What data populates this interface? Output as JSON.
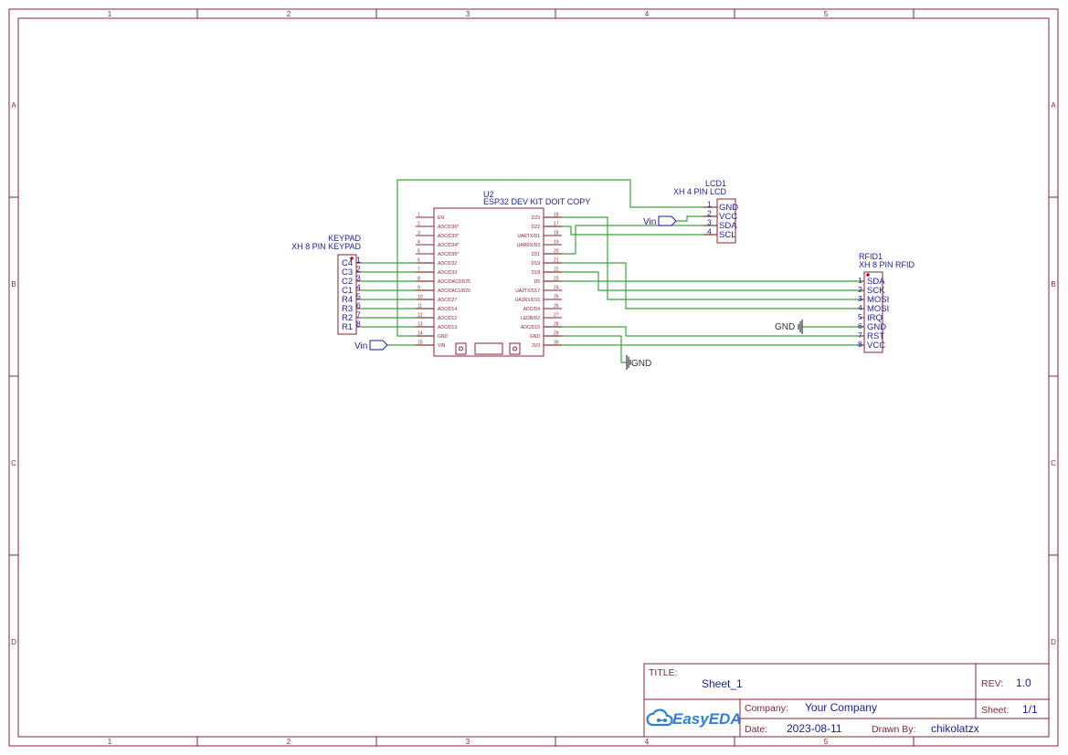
{
  "frame": {
    "columns": [
      "1",
      "2",
      "3",
      "4",
      "5"
    ],
    "rows": [
      "A",
      "B",
      "C",
      "D"
    ]
  },
  "colors": {
    "frame": "#8b2232",
    "wire": "#3aa43a",
    "text": "#1a1aaa",
    "logo": "#2f7fd6"
  },
  "esp32": {
    "designator": "U2",
    "name": "ESP32 DEV KIT DOIT COPY",
    "left_pins": [
      {
        "num": "1",
        "name": "EN"
      },
      {
        "num": "2",
        "name": "ADC/D36*"
      },
      {
        "num": "3",
        "name": "ADC/D39*"
      },
      {
        "num": "4",
        "name": "ADC/D34*"
      },
      {
        "num": "5",
        "name": "ADC/D35*"
      },
      {
        "num": "6",
        "name": "ADC/D32"
      },
      {
        "num": "7",
        "name": "ADC/D33"
      },
      {
        "num": "8",
        "name": "ADC/DAC0/D25"
      },
      {
        "num": "9",
        "name": "ADC/DAC1/D26"
      },
      {
        "num": "10",
        "name": "ADC/D27"
      },
      {
        "num": "11",
        "name": "ADC/D14"
      },
      {
        "num": "12",
        "name": "ADC/D12"
      },
      {
        "num": "13",
        "name": "ADC/D13"
      },
      {
        "num": "14",
        "name": "GND"
      },
      {
        "num": "15",
        "name": "VIN"
      }
    ],
    "right_pins": [
      {
        "num": "16",
        "name": "D23"
      },
      {
        "num": "17",
        "name": "D22"
      },
      {
        "num": "18",
        "name": "UARTX/D1"
      },
      {
        "num": "19",
        "name": "UARRX/D3"
      },
      {
        "num": "20",
        "name": "D21"
      },
      {
        "num": "21",
        "name": "D19"
      },
      {
        "num": "22",
        "name": "D18"
      },
      {
        "num": "23",
        "name": "D5"
      },
      {
        "num": "24",
        "name": "UA2TX/D17"
      },
      {
        "num": "25",
        "name": "UA2RX/D16"
      },
      {
        "num": "26",
        "name": "ADC/D4"
      },
      {
        "num": "27",
        "name": "LEDB/D2"
      },
      {
        "num": "28",
        "name": "ADC/D15"
      },
      {
        "num": "29",
        "name": "GND"
      },
      {
        "num": "30",
        "name": "3V3"
      }
    ]
  },
  "keypad": {
    "designator": "KEYPAD",
    "name": "XH 8 PIN KEYPAD",
    "pins": [
      {
        "num": "1",
        "name": "C4"
      },
      {
        "num": "2",
        "name": "C3"
      },
      {
        "num": "3",
        "name": "C2"
      },
      {
        "num": "4",
        "name": "C1"
      },
      {
        "num": "5",
        "name": "R4"
      },
      {
        "num": "6",
        "name": "R3"
      },
      {
        "num": "7",
        "name": "R2"
      },
      {
        "num": "8",
        "name": "R1"
      }
    ]
  },
  "lcd": {
    "designator": "LCD1",
    "name": "XH 4 PIN LCD",
    "pins": [
      {
        "num": "1",
        "name": "GND"
      },
      {
        "num": "2",
        "name": "VCC"
      },
      {
        "num": "3",
        "name": "SDA"
      },
      {
        "num": "4",
        "name": "SCL"
      }
    ]
  },
  "rfid": {
    "designator": "RFID1",
    "name": "XH 8 PIN RFID",
    "pins": [
      {
        "num": "1",
        "name": "SDA"
      },
      {
        "num": "2",
        "name": "SCK"
      },
      {
        "num": "3",
        "name": "MOSI"
      },
      {
        "num": "4",
        "name": "MOSI"
      },
      {
        "num": "5",
        "name": "IRQ"
      },
      {
        "num": "6",
        "name": "GND"
      },
      {
        "num": "7",
        "name": "RST"
      },
      {
        "num": "8",
        "name": "VCC"
      }
    ]
  },
  "net_labels": {
    "vin_lcd": "Vin",
    "vin_esp": "Vin",
    "gnd_esp": "GND",
    "gnd_rfid": "GND"
  },
  "title_block": {
    "title_label": "TITLE:",
    "title_value": "Sheet_1",
    "rev_label": "REV:",
    "rev_value": "1.0",
    "company_label": "Company:",
    "company_value": "Your Company",
    "sheet_label": "Sheet:",
    "sheet_value": "1/1",
    "date_label": "Date:",
    "date_value": "2023-08-11",
    "drawn_label": "Drawn By:",
    "drawn_value": "chikolatzx",
    "logo_text": "EasyEDA"
  }
}
